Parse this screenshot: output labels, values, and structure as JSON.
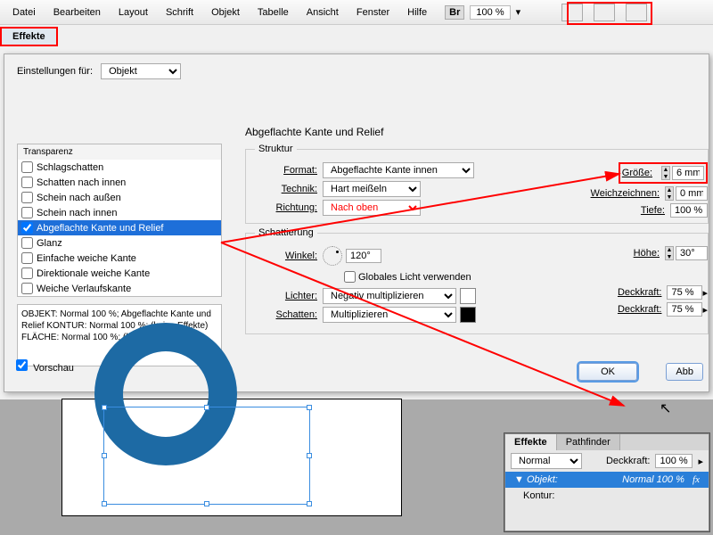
{
  "menu": [
    "Datei",
    "Bearbeiten",
    "Layout",
    "Schrift",
    "Objekt",
    "Tabelle",
    "Ansicht",
    "Fenster",
    "Hilfe"
  ],
  "zoom": "100 %",
  "br_label": "Br",
  "tab": "Effekte",
  "settings_for_label": "Einstellungen für:",
  "settings_for_value": "Objekt",
  "panel_title": "Abgeflachte Kante und Relief",
  "effects_header": "Transparenz",
  "effects": [
    "Schlagschatten",
    "Schatten nach innen",
    "Schein nach außen",
    "Schein nach innen",
    "Abgeflachte Kante und Relief",
    "Glanz",
    "Einfache weiche Kante",
    "Direktionale weiche Kante",
    "Weiche Verlaufskante"
  ],
  "effects_checked": [
    false,
    false,
    false,
    false,
    true,
    false,
    false,
    false,
    false
  ],
  "selected_index": 4,
  "summary": "OBJEKT: Normal 100 %; Abgeflachte Kante und Relief\nKONTUR: Normal 100 %; (keine Effekte)\nFLÄCHE: Normal 100 %; (keine Effekte)",
  "preview_label": "Vorschau",
  "struktur": {
    "legend": "Struktur",
    "format_label": "Format:",
    "format": "Abgeflachte Kante innen",
    "technik_label": "Technik:",
    "technik": "Hart meißeln",
    "richtung_label": "Richtung:",
    "richtung": "Nach oben",
    "groesse_label": "Größe:",
    "groesse": "6 mm",
    "weich_label": "Weichzeichnen:",
    "weich": "0 mm",
    "tiefe_label": "Tiefe:",
    "tiefe": "100 %"
  },
  "schatt": {
    "legend": "Schattierung",
    "winkel_label": "Winkel:",
    "winkel": "120°",
    "global_label": "Globales Licht verwenden",
    "lichter_label": "Lichter:",
    "lichter": "Negativ multiplizieren",
    "schatten_label": "Schatten:",
    "schatten": "Multiplizieren",
    "hoehe_label": "Höhe:",
    "hoehe": "30°",
    "deck_label": "Deckkraft:",
    "deck1": "75 %",
    "deck2": "75 %"
  },
  "ok": "OK",
  "cancel": "Abb",
  "panel": {
    "tabs": [
      "Effekte",
      "Pathfinder"
    ],
    "mode": "Normal",
    "deck_label": "Deckkraft:",
    "deck": "100 %",
    "obj": "Objekt:",
    "obj_val": "Normal 100 %",
    "kontur": "Kontur:"
  }
}
